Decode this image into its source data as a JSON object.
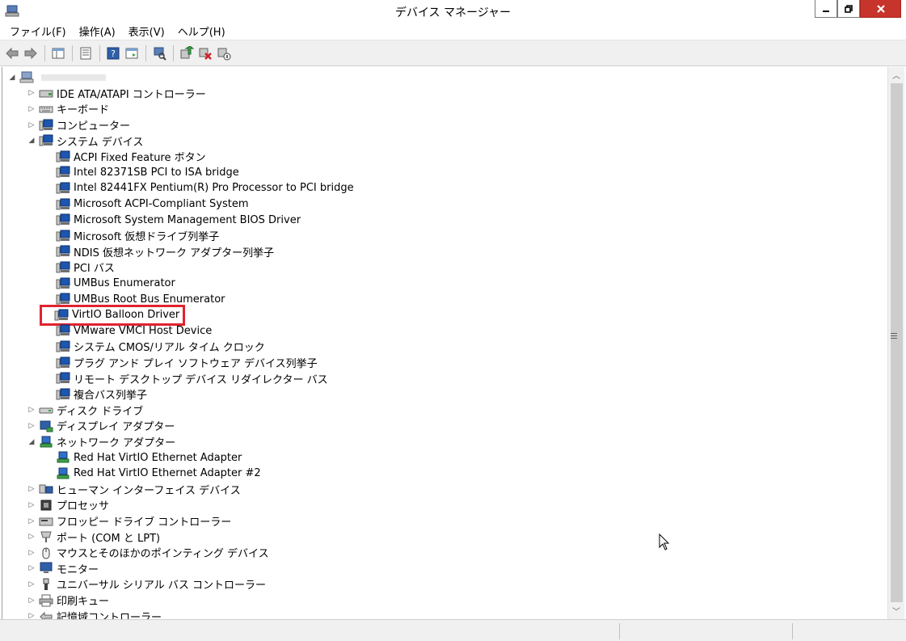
{
  "window": {
    "title": "デバイス マネージャー"
  },
  "menu": [
    "ファイル(F)",
    "操作(A)",
    "表示(V)",
    "ヘルプ(H)"
  ],
  "tree": [
    {
      "depth": 0,
      "exp": "open",
      "icon": "computer-root-icon",
      "label": ""
    },
    {
      "depth": 1,
      "exp": "closed",
      "icon": "ide-controller-icon",
      "label": "IDE ATA/ATAPI コントローラー"
    },
    {
      "depth": 1,
      "exp": "closed",
      "icon": "keyboard-icon",
      "label": "キーボード"
    },
    {
      "depth": 1,
      "exp": "closed",
      "icon": "computer-icon",
      "label": "コンピューター"
    },
    {
      "depth": 1,
      "exp": "open",
      "icon": "system-device-icon",
      "label": "システム デバイス"
    },
    {
      "depth": 2,
      "exp": "none",
      "icon": "system-device-icon",
      "label": "ACPI Fixed Feature ボタン"
    },
    {
      "depth": 2,
      "exp": "none",
      "icon": "system-device-icon",
      "label": "Intel 82371SB PCI to ISA bridge"
    },
    {
      "depth": 2,
      "exp": "none",
      "icon": "system-device-icon",
      "label": "Intel 82441FX Pentium(R) Pro Processor to PCI bridge"
    },
    {
      "depth": 2,
      "exp": "none",
      "icon": "system-device-icon",
      "label": "Microsoft ACPI-Compliant System"
    },
    {
      "depth": 2,
      "exp": "none",
      "icon": "system-device-icon",
      "label": "Microsoft System Management BIOS Driver"
    },
    {
      "depth": 2,
      "exp": "none",
      "icon": "system-device-icon",
      "label": "Microsoft 仮想ドライブ列挙子"
    },
    {
      "depth": 2,
      "exp": "none",
      "icon": "system-device-icon",
      "label": "NDIS 仮想ネットワーク アダプター列挙子"
    },
    {
      "depth": 2,
      "exp": "none",
      "icon": "system-device-icon",
      "label": "PCI バス"
    },
    {
      "depth": 2,
      "exp": "none",
      "icon": "system-device-icon",
      "label": "UMBus Enumerator"
    },
    {
      "depth": 2,
      "exp": "none",
      "icon": "system-device-icon",
      "label": "UMBus Root Bus Enumerator"
    },
    {
      "depth": 2,
      "exp": "none",
      "icon": "system-device-icon",
      "label": "VirtIO Balloon Driver",
      "highlight": true
    },
    {
      "depth": 2,
      "exp": "none",
      "icon": "system-device-icon",
      "label": "VMware VMCI Host Device"
    },
    {
      "depth": 2,
      "exp": "none",
      "icon": "system-device-icon",
      "label": "システム CMOS/リアル タイム クロック"
    },
    {
      "depth": 2,
      "exp": "none",
      "icon": "system-device-icon",
      "label": "プラグ アンド プレイ ソフトウェア デバイス列挙子"
    },
    {
      "depth": 2,
      "exp": "none",
      "icon": "system-device-icon",
      "label": "リモート デスクトップ デバイス リダイレクター バス"
    },
    {
      "depth": 2,
      "exp": "none",
      "icon": "system-device-icon",
      "label": "複合バス列挙子"
    },
    {
      "depth": 1,
      "exp": "closed",
      "icon": "disk-drive-icon",
      "label": "ディスク ドライブ"
    },
    {
      "depth": 1,
      "exp": "closed",
      "icon": "display-adapter-icon",
      "label": "ディスプレイ アダプター"
    },
    {
      "depth": 1,
      "exp": "open",
      "icon": "network-adapter-icon",
      "label": "ネットワーク アダプター"
    },
    {
      "depth": 2,
      "exp": "none",
      "icon": "network-adapter-icon",
      "label": "Red Hat VirtIO Ethernet Adapter"
    },
    {
      "depth": 2,
      "exp": "none",
      "icon": "network-adapter-icon",
      "label": "Red Hat VirtIO Ethernet Adapter #2"
    },
    {
      "depth": 1,
      "exp": "closed",
      "icon": "hid-icon",
      "label": "ヒューマン インターフェイス デバイス"
    },
    {
      "depth": 1,
      "exp": "closed",
      "icon": "processor-icon",
      "label": "プロセッサ"
    },
    {
      "depth": 1,
      "exp": "closed",
      "icon": "floppy-controller-icon",
      "label": "フロッピー ドライブ コントローラー"
    },
    {
      "depth": 1,
      "exp": "closed",
      "icon": "port-icon",
      "label": "ポート (COM と LPT)"
    },
    {
      "depth": 1,
      "exp": "closed",
      "icon": "mouse-icon",
      "label": "マウスとそのほかのポインティング デバイス"
    },
    {
      "depth": 1,
      "exp": "closed",
      "icon": "monitor-icon",
      "label": "モニター"
    },
    {
      "depth": 1,
      "exp": "closed",
      "icon": "usb-icon",
      "label": "ユニバーサル シリアル バス コントローラー"
    },
    {
      "depth": 1,
      "exp": "closed",
      "icon": "printer-icon",
      "label": "印刷キュー"
    },
    {
      "depth": 1,
      "exp": "closed",
      "icon": "storage-controller-icon",
      "label": "記憶域コントローラー"
    }
  ],
  "toolbar": [
    "back-arrow-icon",
    "forward-arrow-icon",
    "|",
    "show-hide-console-tree-icon",
    "|",
    "properties-icon",
    "|",
    "help-icon",
    "show-action-pane-icon",
    "|",
    "scan-hardware-changes-icon",
    "|",
    "update-driver-icon",
    "uninstall-device-icon",
    "disable-device-icon"
  ],
  "colors": {
    "highlight_border": "#e0232f",
    "close_button": "#c7342b"
  }
}
